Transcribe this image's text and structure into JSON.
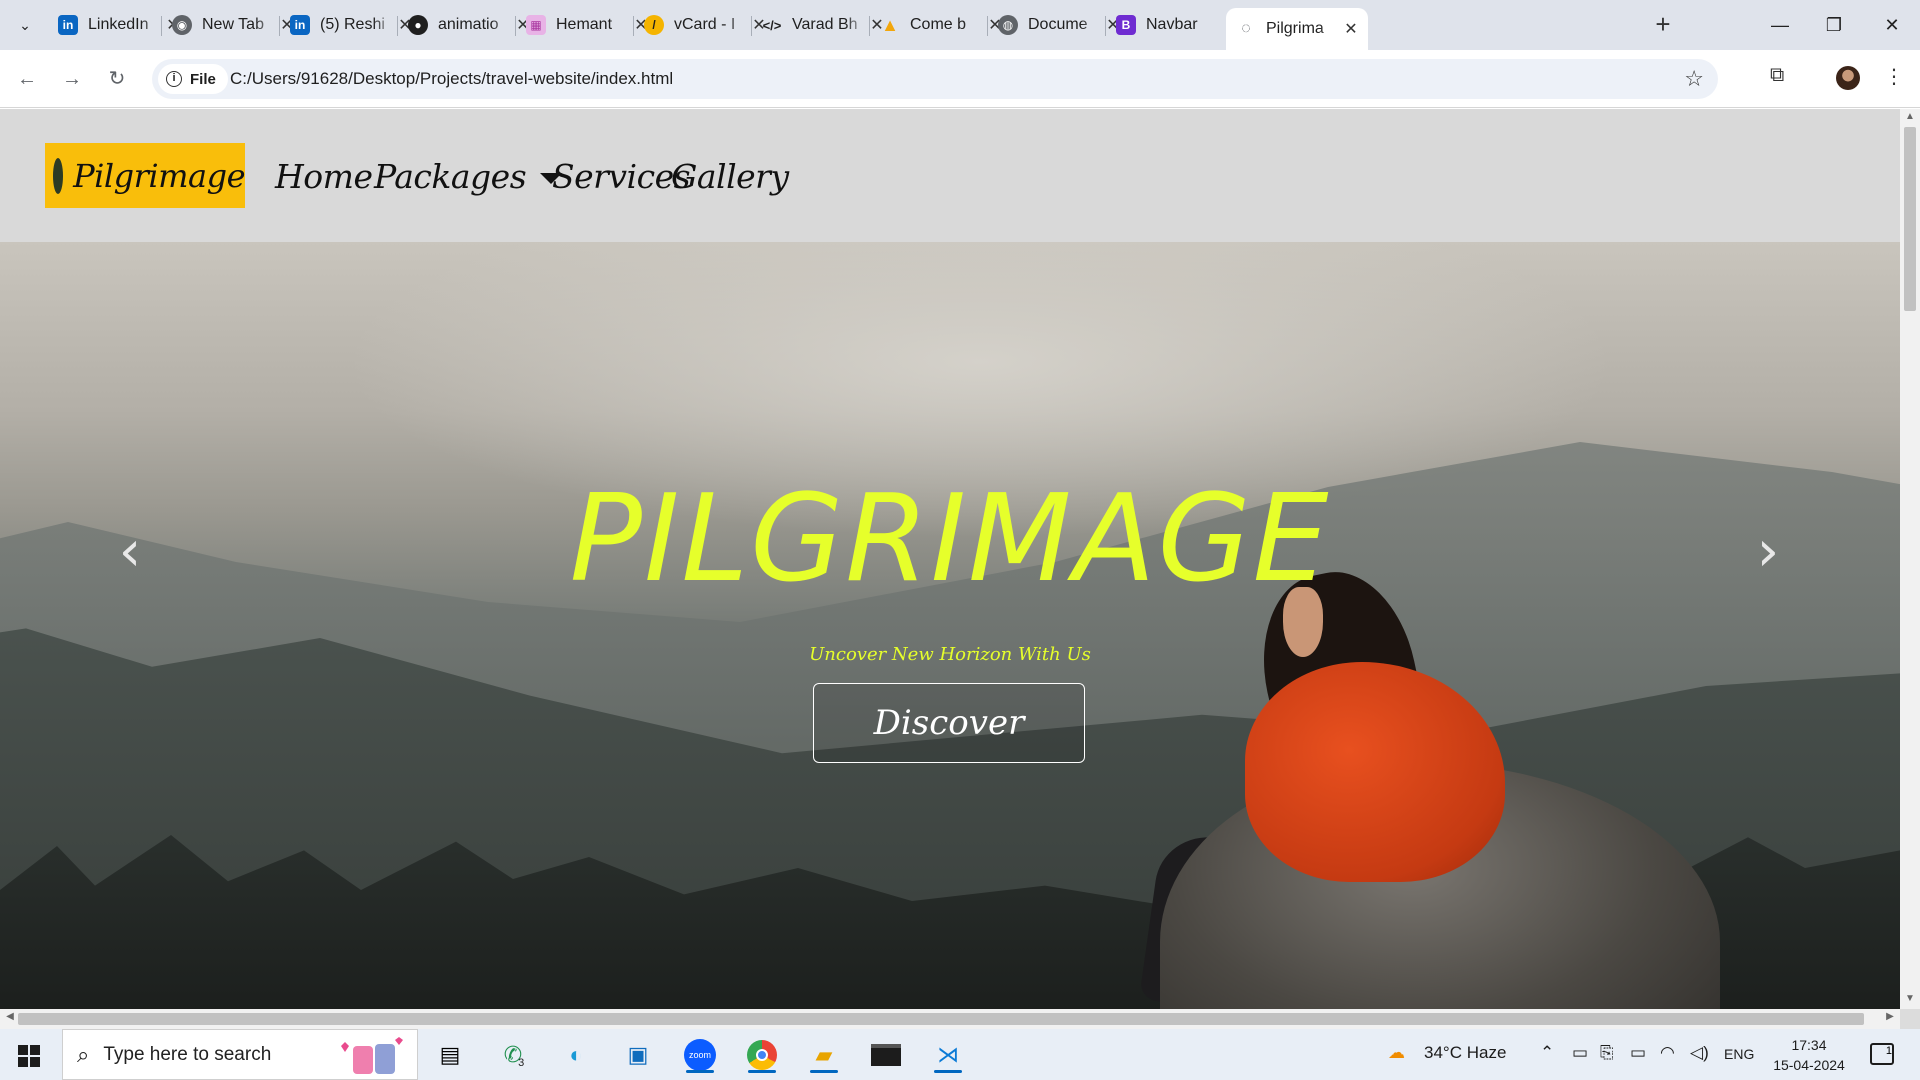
{
  "browser": {
    "tabs": [
      {
        "title": "LinkedIn",
        "icon": "linkedin-icon",
        "color": "#0a66c2"
      },
      {
        "title": "New Tab",
        "icon": "chrome-icon",
        "color": "#5f6368"
      },
      {
        "title": "(5) Reshi",
        "icon": "linkedin-icon",
        "color": "#0a66c2"
      },
      {
        "title": "animatio",
        "icon": "github-icon",
        "color": "#1f1f1f"
      },
      {
        "title": "Hemant",
        "icon": "canva-icon",
        "color": "#c85ec9"
      },
      {
        "title": "vCard - I",
        "icon": "vcard-icon",
        "color": "#f5b400"
      },
      {
        "title": "Varad Bh",
        "icon": "code-icon",
        "color": "#1f1f1f"
      },
      {
        "title": "Come b",
        "icon": "figma-icon",
        "color": "#f2a60c"
      },
      {
        "title": "Docume",
        "icon": "globe-icon",
        "color": "#5f6368"
      },
      {
        "title": "Navbar",
        "icon": "bootstrap-icon",
        "color": "#6f2cd1"
      },
      {
        "title": "Pilgrima",
        "icon": "page-icon",
        "color": "#5f6368"
      }
    ],
    "address": {
      "chip_label": "File",
      "url": "C:/Users/91628/Desktop/Projects/travel-website/index.html"
    }
  },
  "site": {
    "brand": "Pilgrimage",
    "menu": {
      "home": "Home",
      "packages": "Packages",
      "services": "Services",
      "gallery": "Gallery"
    },
    "hero": {
      "title": "PILGRIMAGE",
      "subtitle": "Uncover New Horizon With Us",
      "button": "Discover",
      "prev": "‹",
      "next": "›"
    },
    "colors": {
      "brand_bg": "#f9be0b",
      "title": "#e6ff2b",
      "nav_bg": "#d9d9d9"
    }
  },
  "taskbar": {
    "search_placeholder": "Type here to search",
    "whatsapp_badge": "3",
    "weather": "34°C  Haze",
    "language": "ENG",
    "time": "17:34",
    "date": "15-04-2024",
    "notification_count": "1"
  }
}
